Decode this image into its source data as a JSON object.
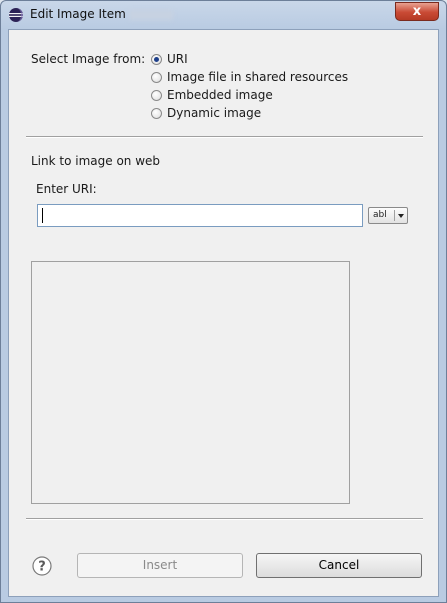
{
  "window": {
    "title": "Edit Image Item",
    "close_glyph": "x"
  },
  "source": {
    "label": "Select Image from:",
    "options": [
      {
        "label": "URI",
        "checked": true
      },
      {
        "label": "Image file in shared resources",
        "checked": false
      },
      {
        "label": "Embedded image",
        "checked": false
      },
      {
        "label": "Dynamic image",
        "checked": false
      }
    ]
  },
  "web": {
    "section_label": "Link to image on web",
    "uri_label": "Enter URI:",
    "uri_value": "",
    "uri_placeholder": "",
    "expression_button": "abl"
  },
  "footer": {
    "help_glyph": "?",
    "insert_label": "Insert",
    "cancel_label": "Cancel"
  },
  "icons": {
    "app": "eclipse-icon",
    "help": "help-icon",
    "dropdown": "chevron-down-icon"
  },
  "colors": {
    "client_bg": "#f0f0f0",
    "close_button": "#c94a35",
    "radio_dot": "#1d3f8a",
    "input_border": "#7a9cc0"
  }
}
